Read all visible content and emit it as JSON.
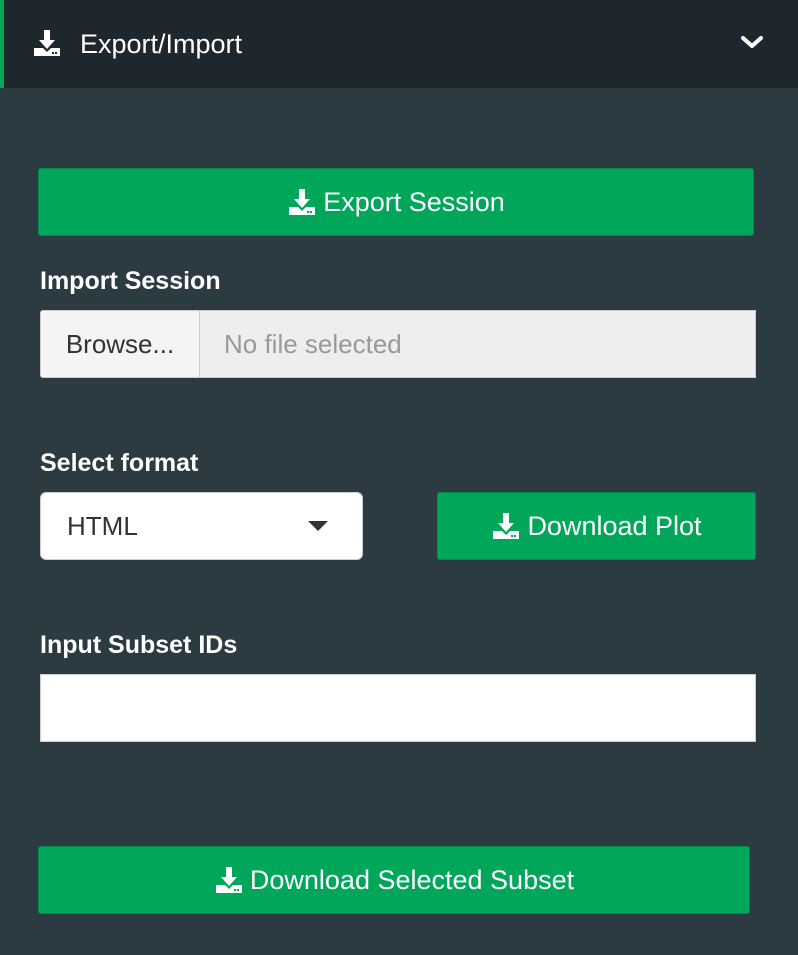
{
  "header": {
    "title": "Export/Import",
    "icon": "download-icon",
    "chevron_icon": "chevron-down-icon",
    "accent_color": "#00a65a"
  },
  "export_session": {
    "label": "Export Session",
    "icon": "download-icon"
  },
  "import_session": {
    "label": "Import Session",
    "browse_label": "Browse...",
    "file_placeholder": "No file selected"
  },
  "format": {
    "label": "Select format",
    "selected": "HTML"
  },
  "download_plot": {
    "label": "Download Plot",
    "icon": "download-icon"
  },
  "subset": {
    "label": "Input Subset IDs",
    "value": "",
    "placeholder": ""
  },
  "download_subset": {
    "label": "Download Selected Subset",
    "icon": "download-icon"
  },
  "colors": {
    "background": "#2c3b41",
    "header_bg": "#1e282c",
    "button_green": "#00a65a"
  }
}
